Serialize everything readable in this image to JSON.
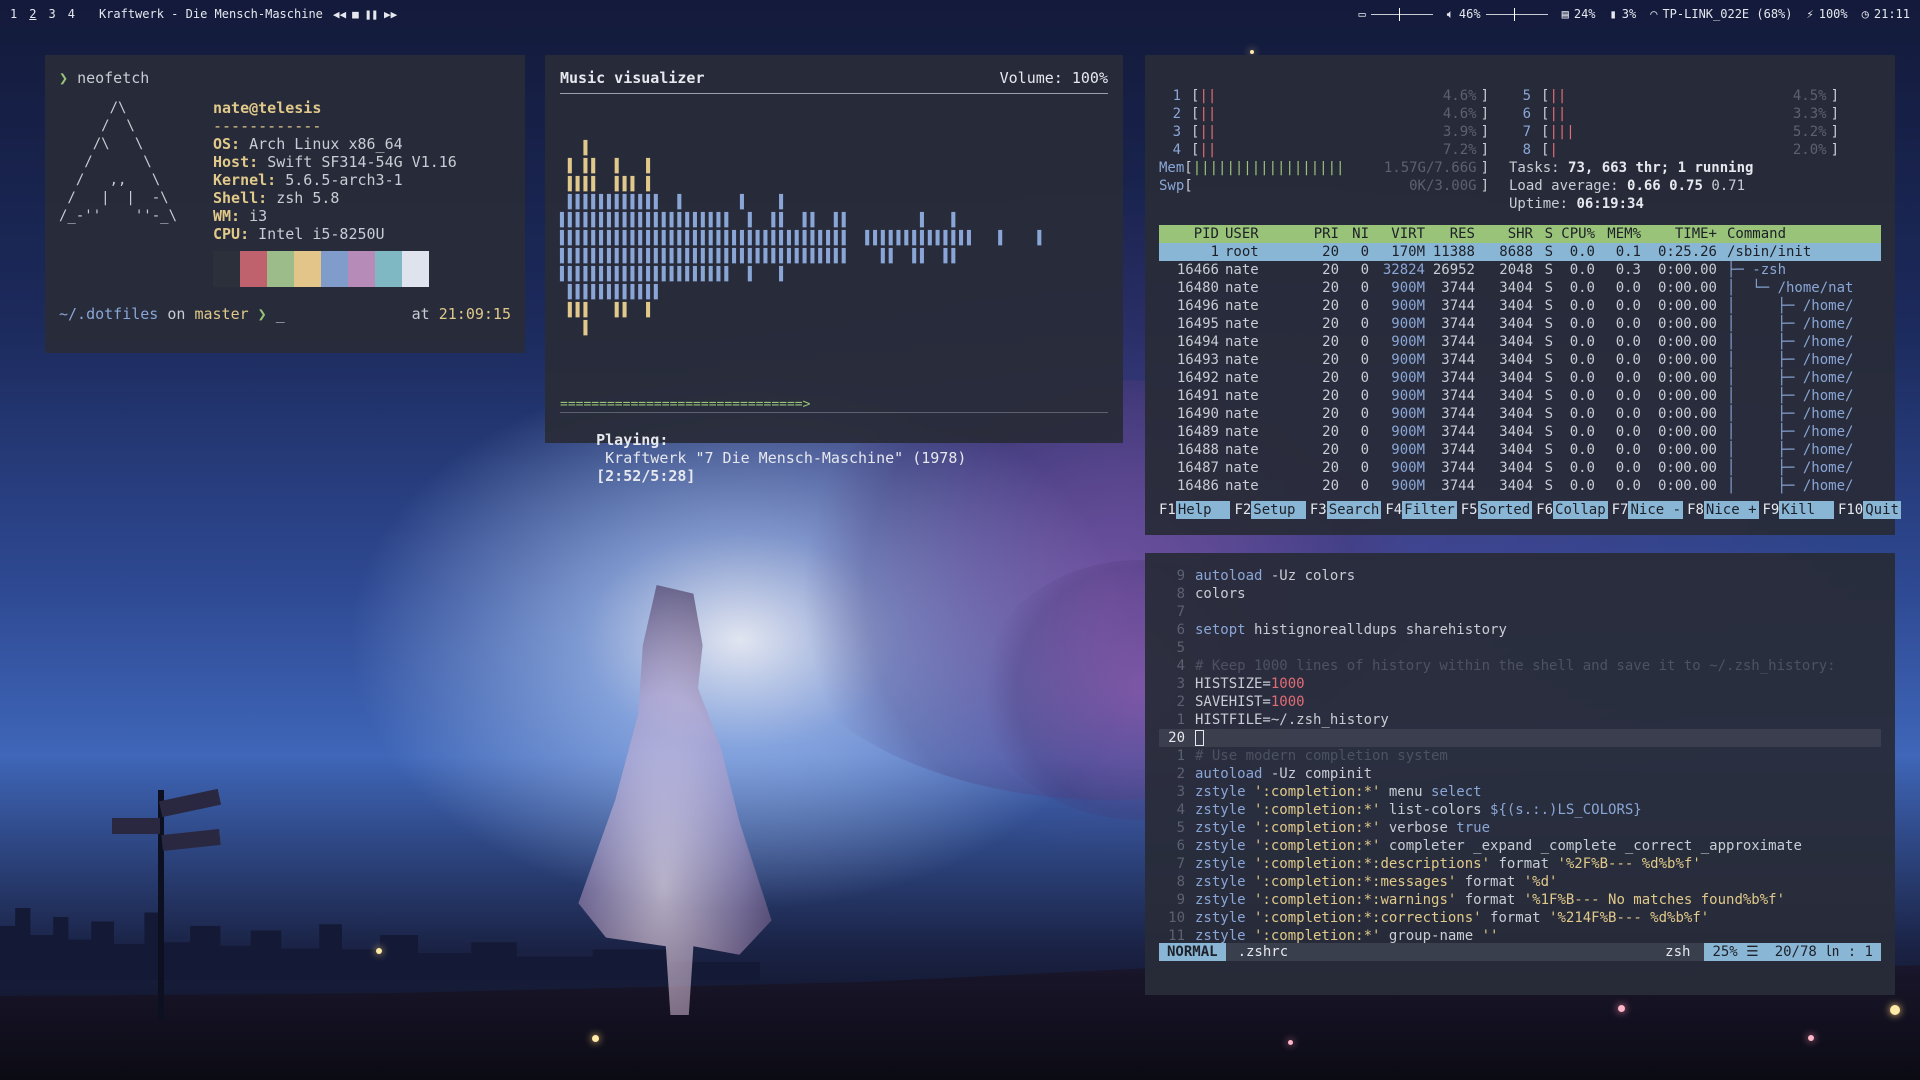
{
  "topbar": {
    "workspaces": [
      "1",
      "2",
      "3",
      "4"
    ],
    "now_playing": "Kraftwerk - Die Mensch-Maschine",
    "volume": "46%",
    "brightness_level": 0.46,
    "volume_level": 0.46,
    "memory": "24%",
    "battery_drain": "3%",
    "wifi": "TP-LINK_022E (68%)",
    "battery": "100%",
    "clock": "21:11"
  },
  "neofetch": {
    "command": "neofetch",
    "art": [
      "      /\\",
      "     /  \\",
      "    /\\   \\",
      "   /      \\",
      "  /   ,,   \\",
      " /   |  |  -\\",
      "/_-''    ''-_\\"
    ],
    "user_host": "nate@telesis",
    "separator": "------------",
    "info": [
      {
        "label": "OS:",
        "value": "Arch Linux x86_64"
      },
      {
        "label": "Host:",
        "value": "Swift SF314-54G V1.16"
      },
      {
        "label": "Kernel:",
        "value": "5.6.5-arch3-1"
      },
      {
        "label": "Shell:",
        "value": "zsh 5.8"
      },
      {
        "label": "WM:",
        "value": "i3"
      },
      {
        "label": "CPU:",
        "value": "Intel i5-8250U"
      }
    ],
    "swatch_colors": [
      "#2c303b",
      "#c0616e",
      "#9cbd8a",
      "#e3c489",
      "#7f9ccb",
      "#b68bb8",
      "#7fb8c2",
      "#dfe3ee"
    ],
    "prompt_dir": "~/.dotfiles",
    "prompt_on": "on",
    "prompt_branch": "master",
    "prompt_cursor": "_",
    "prompt_at": "at",
    "prompt_time": "21:09:15"
  },
  "visualizer": {
    "title": "Music visualizer",
    "volume": "Volume: 100%",
    "progress_text": "===============================>",
    "playing_label": "Playing:",
    "playing_text": "Kraftwerk \"7 Die Mensch-Maschine\" (1978)",
    "playing_time": "[2:52/5:28]"
  },
  "htop": {
    "cpus_left": [
      {
        "n": "1",
        "bars": "||",
        "pct": "4.6%"
      },
      {
        "n": "2",
        "bars": "||",
        "pct": "4.6%"
      },
      {
        "n": "3",
        "bars": "||",
        "pct": "3.9%"
      },
      {
        "n": "4",
        "bars": "||",
        "pct": "7.2%"
      }
    ],
    "cpus_right": [
      {
        "n": "5",
        "bars": "||",
        "pct": "4.5%"
      },
      {
        "n": "6",
        "bars": "||",
        "pct": "3.3%"
      },
      {
        "n": "7",
        "bars": "|||",
        "pct": "5.2%"
      },
      {
        "n": "8",
        "bars": "|",
        "pct": "2.0%"
      }
    ],
    "mem_label": "Mem",
    "mem_bars": "||||||||||||||||||",
    "mem_value": "1.57G/7.66G",
    "swp_label": "Swp",
    "swp_value": "0K/3.00G",
    "tasks_label": "Tasks:",
    "tasks_value": "73, 663 thr; 1 running",
    "load_label": "Load average:",
    "load_1": "0.66",
    "load_5": "0.75",
    "load_15": "0.71",
    "uptime_label": "Uptime:",
    "uptime_value": "06:19:34",
    "columns": [
      "PID",
      "USER",
      "PRI",
      "NI",
      "VIRT",
      "RES",
      "SHR",
      "S",
      "CPU%",
      "MEM%",
      "TIME+",
      "Command"
    ],
    "processes": [
      {
        "pid": "1",
        "user": "root",
        "pri": "20",
        "ni": "0",
        "virt": "170M",
        "res": "11388",
        "shr": "8688",
        "s": "S",
        "cpu": "0.0",
        "mem": "0.1",
        "time": "0:25.26",
        "cmd": "/sbin/init"
      },
      {
        "pid": "16466",
        "user": "nate",
        "pri": "20",
        "ni": "0",
        "virt": "32824",
        "res": "26952",
        "shr": "2048",
        "s": "S",
        "cpu": "0.0",
        "mem": "0.3",
        "time": "0:00.00",
        "cmd": "├─ -zsh"
      },
      {
        "pid": "16480",
        "user": "nate",
        "pri": "20",
        "ni": "0",
        "virt": "900M",
        "res": "3744",
        "shr": "3404",
        "s": "S",
        "cpu": "0.0",
        "mem": "0.0",
        "time": "0:00.00",
        "cmd": "│  └─ /home/nat"
      },
      {
        "pid": "16496",
        "user": "nate",
        "pri": "20",
        "ni": "0",
        "virt": "900M",
        "res": "3744",
        "shr": "3404",
        "s": "S",
        "cpu": "0.0",
        "mem": "0.0",
        "time": "0:00.00",
        "cmd": "│     ├─ /home/"
      },
      {
        "pid": "16495",
        "user": "nate",
        "pri": "20",
        "ni": "0",
        "virt": "900M",
        "res": "3744",
        "shr": "3404",
        "s": "S",
        "cpu": "0.0",
        "mem": "0.0",
        "time": "0:00.00",
        "cmd": "│     ├─ /home/"
      },
      {
        "pid": "16494",
        "user": "nate",
        "pri": "20",
        "ni": "0",
        "virt": "900M",
        "res": "3744",
        "shr": "3404",
        "s": "S",
        "cpu": "0.0",
        "mem": "0.0",
        "time": "0:00.00",
        "cmd": "│     ├─ /home/"
      },
      {
        "pid": "16493",
        "user": "nate",
        "pri": "20",
        "ni": "0",
        "virt": "900M",
        "res": "3744",
        "shr": "3404",
        "s": "S",
        "cpu": "0.0",
        "mem": "0.0",
        "time": "0:00.00",
        "cmd": "│     ├─ /home/"
      },
      {
        "pid": "16492",
        "user": "nate",
        "pri": "20",
        "ni": "0",
        "virt": "900M",
        "res": "3744",
        "shr": "3404",
        "s": "S",
        "cpu": "0.0",
        "mem": "0.0",
        "time": "0:00.00",
        "cmd": "│     ├─ /home/"
      },
      {
        "pid": "16491",
        "user": "nate",
        "pri": "20",
        "ni": "0",
        "virt": "900M",
        "res": "3744",
        "shr": "3404",
        "s": "S",
        "cpu": "0.0",
        "mem": "0.0",
        "time": "0:00.00",
        "cmd": "│     ├─ /home/"
      },
      {
        "pid": "16490",
        "user": "nate",
        "pri": "20",
        "ni": "0",
        "virt": "900M",
        "res": "3744",
        "shr": "3404",
        "s": "S",
        "cpu": "0.0",
        "mem": "0.0",
        "time": "0:00.00",
        "cmd": "│     ├─ /home/"
      },
      {
        "pid": "16489",
        "user": "nate",
        "pri": "20",
        "ni": "0",
        "virt": "900M",
        "res": "3744",
        "shr": "3404",
        "s": "S",
        "cpu": "0.0",
        "mem": "0.0",
        "time": "0:00.00",
        "cmd": "│     ├─ /home/"
      },
      {
        "pid": "16488",
        "user": "nate",
        "pri": "20",
        "ni": "0",
        "virt": "900M",
        "res": "3744",
        "shr": "3404",
        "s": "S",
        "cpu": "0.0",
        "mem": "0.0",
        "time": "0:00.00",
        "cmd": "│     ├─ /home/"
      },
      {
        "pid": "16487",
        "user": "nate",
        "pri": "20",
        "ni": "0",
        "virt": "900M",
        "res": "3744",
        "shr": "3404",
        "s": "S",
        "cpu": "0.0",
        "mem": "0.0",
        "time": "0:00.00",
        "cmd": "│     ├─ /home/"
      },
      {
        "pid": "16486",
        "user": "nate",
        "pri": "20",
        "ni": "0",
        "virt": "900M",
        "res": "3744",
        "shr": "3404",
        "s": "S",
        "cpu": "0.0",
        "mem": "0.0",
        "time": "0:00.00",
        "cmd": "│     ├─ /home/"
      }
    ],
    "fkeys": [
      {
        "key": "F1",
        "label": "Help  "
      },
      {
        "key": "F2",
        "label": "Setup "
      },
      {
        "key": "F3",
        "label": "Search"
      },
      {
        "key": "F4",
        "label": "Filter"
      },
      {
        "key": "F5",
        "label": "Sorted"
      },
      {
        "key": "F6",
        "label": "Collap"
      },
      {
        "key": "F7",
        "label": "Nice -"
      },
      {
        "key": "F8",
        "label": "Nice +"
      },
      {
        "key": "F9",
        "label": "Kill  "
      },
      {
        "key": "F10",
        "label": "Quit"
      }
    ]
  },
  "vim": {
    "lines": [
      {
        "n": "9",
        "parts": [
          [
            "kw",
            "autoload"
          ],
          [
            "",
            " -Uz colors"
          ]
        ]
      },
      {
        "n": "8",
        "parts": [
          [
            "",
            "colors"
          ]
        ]
      },
      {
        "n": "7",
        "parts": []
      },
      {
        "n": "6",
        "parts": [
          [
            "kw",
            "setopt"
          ],
          [
            "",
            " histignorealldups sharehistory"
          ]
        ]
      },
      {
        "n": "5",
        "parts": []
      },
      {
        "n": "4",
        "parts": [
          [
            "cmt",
            "# Keep 1000 lines of history within the shell and save it to ~/.zsh_history:"
          ]
        ]
      },
      {
        "n": "3",
        "parts": [
          [
            "",
            "HISTSIZE="
          ],
          [
            "num",
            "1000"
          ]
        ]
      },
      {
        "n": "2",
        "parts": [
          [
            "",
            "SAVEHIST="
          ],
          [
            "num",
            "1000"
          ]
        ]
      },
      {
        "n": "1",
        "parts": [
          [
            "",
            "HISTFILE=~/.zsh_history"
          ]
        ]
      },
      {
        "n": "20",
        "cur": true,
        "parts": []
      },
      {
        "n": "1",
        "parts": [
          [
            "cmt",
            "# Use modern completion system"
          ]
        ]
      },
      {
        "n": "2",
        "parts": [
          [
            "kw",
            "autoload"
          ],
          [
            "",
            " -Uz compinit"
          ]
        ]
      },
      {
        "n": "3",
        "parts": [
          [
            "kw",
            "zstyle"
          ],
          [
            "str",
            " ':completion:*'"
          ],
          [
            "",
            " menu "
          ],
          [
            "kw",
            "select"
          ]
        ]
      },
      {
        "n": "4",
        "parts": [
          [
            "kw",
            "zstyle"
          ],
          [
            "str",
            " ':completion:*'"
          ],
          [
            "",
            " list-colors "
          ],
          [
            "kw",
            "${(s.:.)LS_COLORS}"
          ]
        ]
      },
      {
        "n": "5",
        "parts": [
          [
            "kw",
            "zstyle"
          ],
          [
            "str",
            " ':completion:*'"
          ],
          [
            "",
            " verbose "
          ],
          [
            "kw",
            "true"
          ]
        ]
      },
      {
        "n": "6",
        "parts": [
          [
            "kw",
            "zstyle"
          ],
          [
            "str",
            " ':completion:*'"
          ],
          [
            "",
            " completer _expand _complete _correct _approximate"
          ]
        ]
      },
      {
        "n": "7",
        "parts": [
          [
            "kw",
            "zstyle"
          ],
          [
            "str",
            " ':completion:*:descriptions'"
          ],
          [
            "",
            " format "
          ],
          [
            "str",
            "'%2F%B--- %d%b%f'"
          ]
        ]
      },
      {
        "n": "8",
        "parts": [
          [
            "kw",
            "zstyle"
          ],
          [
            "str",
            " ':completion:*:messages'"
          ],
          [
            "",
            " format "
          ],
          [
            "str",
            "'%d'"
          ]
        ]
      },
      {
        "n": "9",
        "parts": [
          [
            "kw",
            "zstyle"
          ],
          [
            "str",
            " ':completion:*:warnings'"
          ],
          [
            "",
            " format "
          ],
          [
            "str",
            "'%1F%B--- No matches found%b%f'"
          ]
        ]
      },
      {
        "n": "10",
        "parts": [
          [
            "kw",
            "zstyle"
          ],
          [
            "str",
            " ':completion:*:corrections'"
          ],
          [
            "",
            " format "
          ],
          [
            "str",
            "'%214F%B--- %d%b%f'"
          ]
        ]
      },
      {
        "n": "11",
        "parts": [
          [
            "kw",
            "zstyle"
          ],
          [
            "str",
            " ':completion:*'"
          ],
          [
            "",
            " group-name "
          ],
          [
            "str",
            "''"
          ]
        ]
      }
    ],
    "mode": "NORMAL",
    "file": ".zshrc",
    "filetype": "zsh",
    "percent": "25% ☰",
    "position": "20/78 ㏑ :  1"
  }
}
